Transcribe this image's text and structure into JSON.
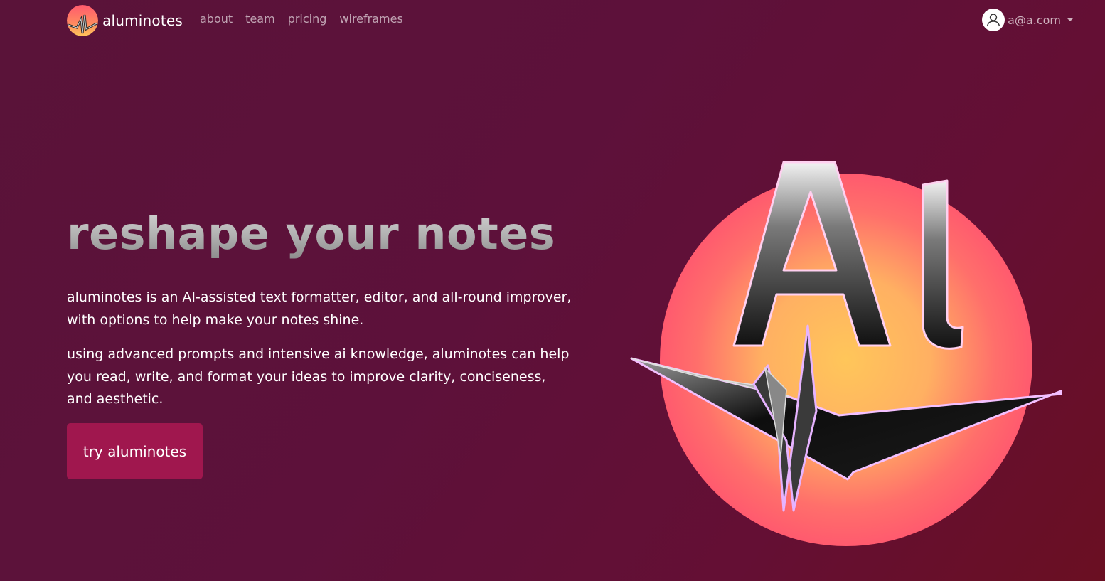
{
  "navbar": {
    "brand": "aluminotes",
    "links": [
      "about",
      "team",
      "pricing",
      "wireframes"
    ],
    "user_email": "a@a.com"
  },
  "hero": {
    "title": "reshape your notes",
    "paragraph_1": "aluminotes is an AI-assisted text formatter, editor, and all-round improver, with options to help make your notes shine.",
    "paragraph_2": "using advanced prompts and intensive ai knowledge, aluminotes can help you read, write, and format your ideas to improve clarity, conciseness, and aesthetic.",
    "cta_label": "try aluminotes",
    "image_text": "AI"
  },
  "colors": {
    "background": "#5d113a",
    "accent": "#a0174e",
    "logo_gradient_top": "#ff5a6e",
    "logo_gradient_bottom": "#ffc65a"
  },
  "icons": {
    "brand_logo": "ai-crane-logo",
    "user": "user-icon",
    "dropdown": "caret-down-icon"
  }
}
